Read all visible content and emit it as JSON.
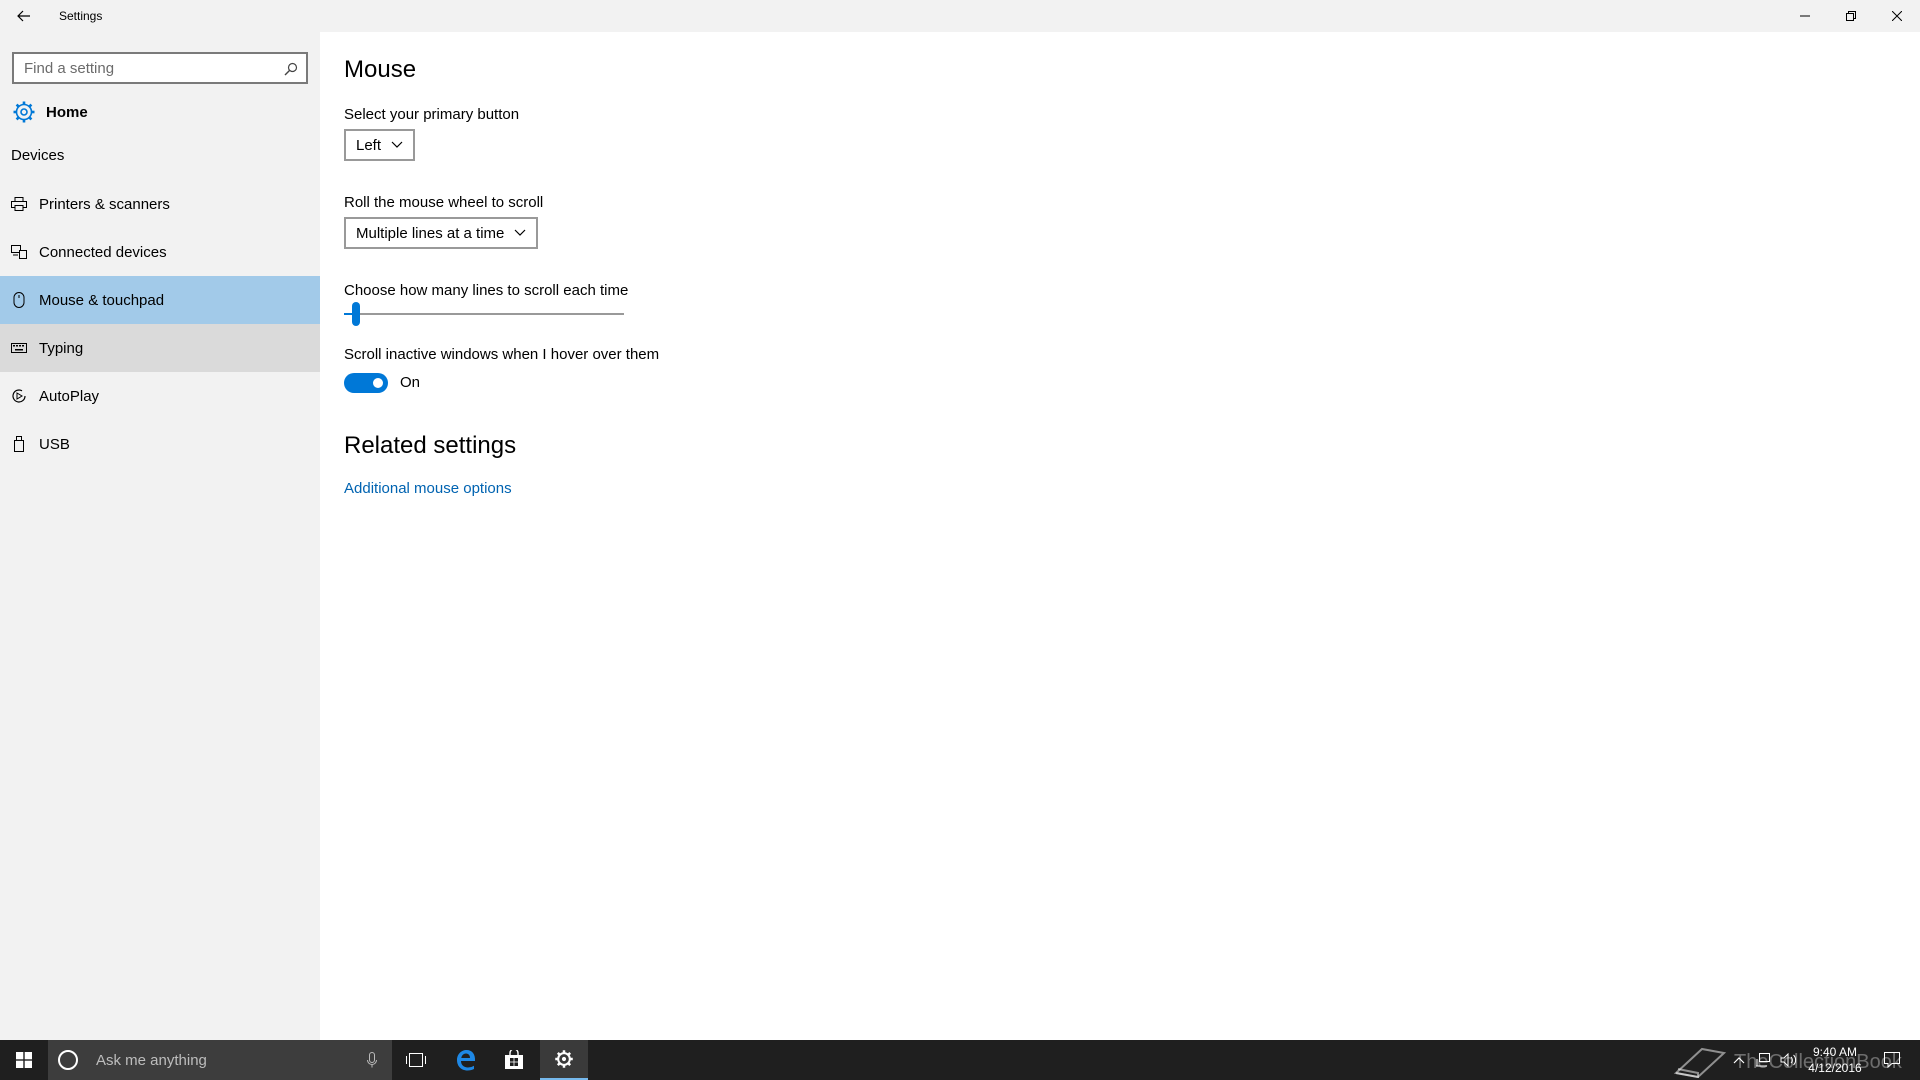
{
  "window": {
    "title": "Settings"
  },
  "sidebar": {
    "search_placeholder": "Find a setting",
    "home_label": "Home",
    "section_title": "Devices",
    "items": [
      {
        "label": "Printers & scanners",
        "icon": "printer-icon"
      },
      {
        "label": "Connected devices",
        "icon": "connected-devices-icon"
      },
      {
        "label": "Mouse & touchpad",
        "icon": "mouse-icon",
        "selected": true
      },
      {
        "label": "Typing",
        "icon": "keyboard-icon"
      },
      {
        "label": "AutoPlay",
        "icon": "autoplay-icon"
      },
      {
        "label": "USB",
        "icon": "usb-icon"
      }
    ]
  },
  "main": {
    "title": "Mouse",
    "primary_button": {
      "label": "Select your primary button",
      "value": "Left"
    },
    "wheel_scroll": {
      "label": "Roll the mouse wheel to scroll",
      "value": "Multiple lines at a time"
    },
    "lines_to_scroll": {
      "label": "Choose how many lines to scroll each time",
      "slider_fraction": 0.03
    },
    "inactive_scroll": {
      "label": "Scroll inactive windows when I hover over them",
      "state_label": "On",
      "on": true
    },
    "related": {
      "title": "Related settings",
      "link": "Additional mouse options"
    }
  },
  "taskbar": {
    "search_placeholder": "Ask me anything",
    "time": "9:40 AM",
    "date": "4/12/2016",
    "watermark_text": "TheCollectionBook"
  },
  "colors": {
    "accent": "#0078d7",
    "link": "#0063b1",
    "selected_bg": "#a2cae9",
    "sidebar_bg": "#f2f2f2",
    "taskbar_bg": "#1f1f1f"
  }
}
